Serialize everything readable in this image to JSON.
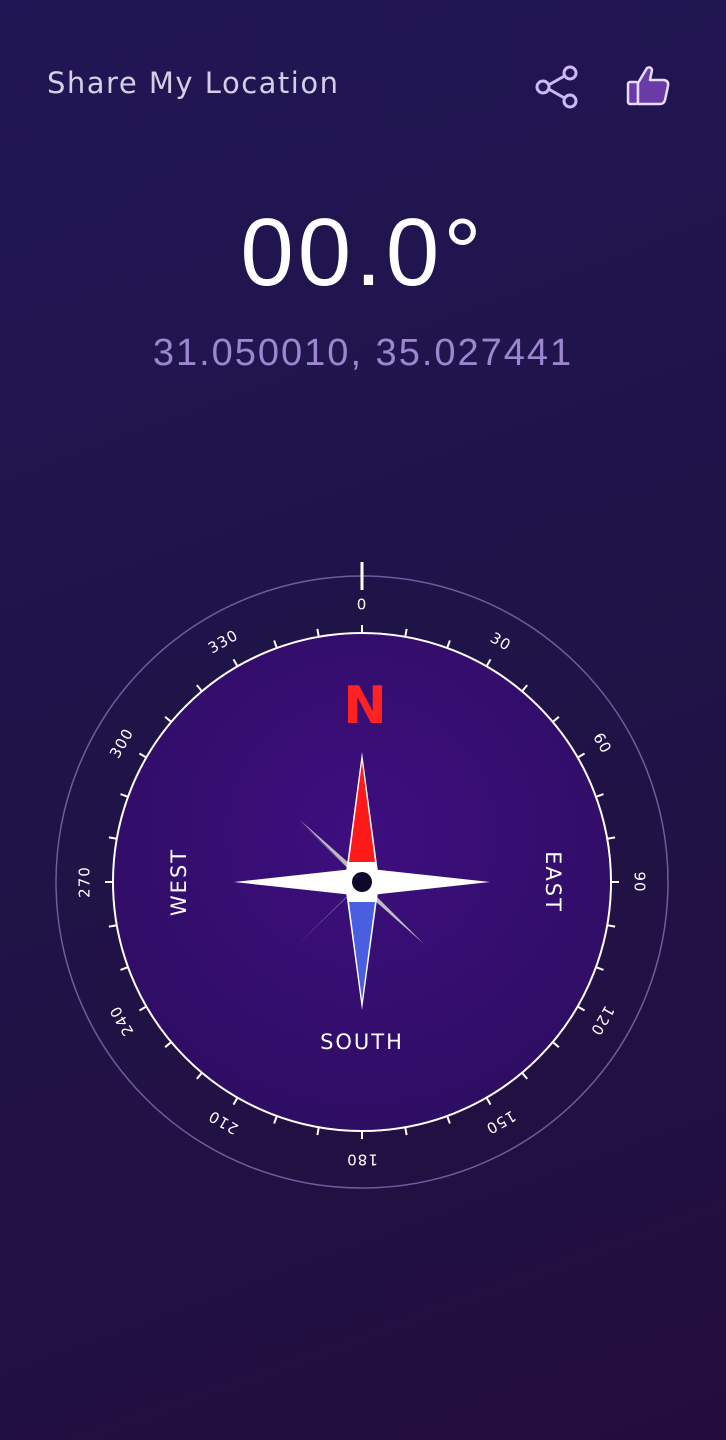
{
  "header": {
    "title": "Share My Location",
    "share_icon": "share-icon",
    "like_icon": "thumbs-up-icon"
  },
  "heading": {
    "value": "00.0°"
  },
  "location": {
    "coordinates": "31.050010, 35.027441"
  },
  "compass": {
    "outer_labels": [
      "0",
      "30",
      "60",
      "90",
      "120",
      "150",
      "180",
      "210",
      "240",
      "270",
      "300",
      "330"
    ],
    "north_letter": "N",
    "east": "EAST",
    "south": "SOUTH",
    "west": "WEST"
  },
  "colors": {
    "north_letter": "#ff2222",
    "needle_north": "#ff1a1a",
    "needle_south": "#4a5fe0",
    "dial_fill": "#3a0d78",
    "like_icon": "#6a3aa6",
    "share_icon": "#cbb8f5"
  }
}
